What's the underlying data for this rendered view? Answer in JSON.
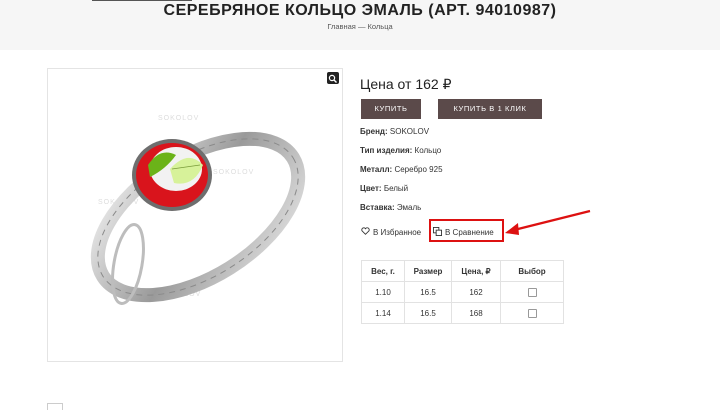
{
  "page": {
    "title": "СЕРЕБРЯНОЕ КОЛЬЦО ЭМАЛЬ (АРТ. 94010987)",
    "breadcrumb": {
      "home": "Главная",
      "separator": "—",
      "current": "Кольца"
    }
  },
  "image": {
    "watermark": "SOKOLOV",
    "zoom_icon": "magnifier-icon"
  },
  "product": {
    "price_label": "Цена от 162",
    "currency": "₽",
    "buy_label": "КУПИТЬ",
    "one_click_label": "КУПИТЬ В 1 КЛИК",
    "props": [
      {
        "label": "Бренд:",
        "value": "SOKOLOV"
      },
      {
        "label": "Тип изделия:",
        "value": "Кольцо"
      },
      {
        "label": "Металл:",
        "value": "Серебро 925"
      },
      {
        "label": "Цвет:",
        "value": "Белый"
      },
      {
        "label": "Вставка:",
        "value": "Эмаль"
      }
    ],
    "favorite_label": "В Избранное",
    "compare_label": "В Сравнение"
  },
  "variants": {
    "headers": [
      "Вес, г.",
      "Размер",
      "Цена, ₽",
      "Выбор"
    ],
    "rows": [
      [
        "1.10",
        "16.5",
        "162"
      ],
      [
        "1.14",
        "16.5",
        "168"
      ]
    ]
  },
  "colors": {
    "button_bg": "#5b4a4a",
    "highlight": "#d11111"
  }
}
